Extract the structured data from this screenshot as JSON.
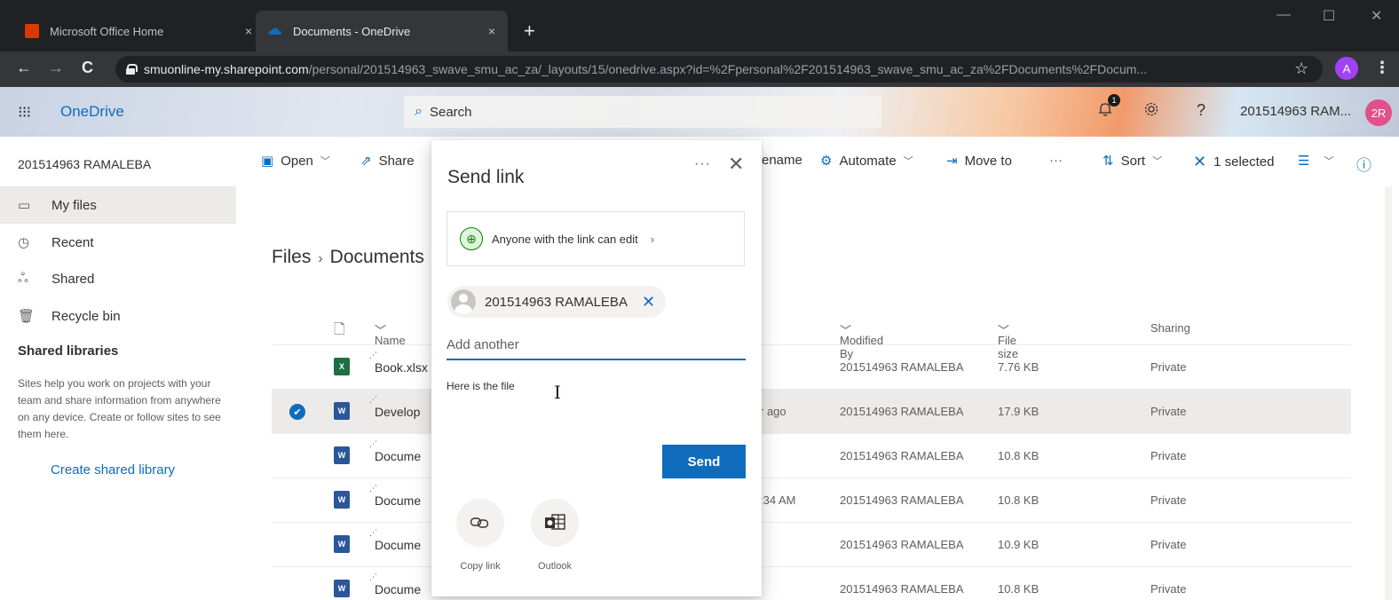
{
  "browser": {
    "tabs": [
      {
        "title": "Microsoft Office Home",
        "close": "×"
      },
      {
        "title": "Documents - OneDrive",
        "close": "×"
      }
    ],
    "new_tab": "+",
    "window": {
      "minimize": "—",
      "maximize": "☐",
      "close": "✕"
    },
    "nav": {
      "back": "←",
      "forward": "→",
      "reload": "C"
    },
    "url_host": "smuonline-my.sharepoint.com",
    "url_path": "/personal/201514963_swave_smu_ac_za/_layouts/15/onedrive.aspx?id=%2Fpersonal%2F201514963_swave_smu_ac_za%2FDocuments%2FDocum...",
    "star": "☆",
    "profile_initial": "A",
    "menu": "⋮"
  },
  "suite": {
    "waffle": "⁝⁝⁝",
    "brand": "OneDrive",
    "search_label": "Search",
    "notification_count": "1",
    "help": "?",
    "user_name": "201514963 RAM...",
    "avatar_initials": "2R"
  },
  "leftnav": {
    "user": "201514963 RAMALEBA",
    "items": [
      {
        "label": "My files",
        "icon": "▭"
      },
      {
        "label": "Recent",
        "icon": "◷"
      },
      {
        "label": "Shared",
        "icon": "ஃ"
      },
      {
        "label": "Recycle bin",
        "icon": "🗑"
      }
    ],
    "section": "Shared libraries",
    "help_text": "Sites help you work on projects with your team and share information from anywhere on any device. Create or follow sites to see them here.",
    "create_link": "Create shared library"
  },
  "commands": {
    "open": "Open",
    "share": "Share",
    "rename": "ename",
    "automate": "Automate",
    "move_to": "Move to",
    "more": "···",
    "sort": "Sort",
    "selected": "1 selected",
    "info": "ⓘ"
  },
  "breadcrumb": {
    "root": "Files",
    "current": "Documents"
  },
  "list": {
    "headers": {
      "name": "Name",
      "modified_by": "Modified By",
      "file_size": "File size",
      "sharing": "Sharing"
    },
    "rows": [
      {
        "name": "Book.xlsx",
        "type": "xlsx",
        "modified": "",
        "modified_by": "201514963 RAMALEBA",
        "size": "7.76 KB",
        "sharing": "Private",
        "selected": false
      },
      {
        "name": "Develop",
        "type": "docx",
        "modified": "r ago",
        "modified_by": "201514963 RAMALEBA",
        "size": "17.9 KB",
        "sharing": "Private",
        "selected": true
      },
      {
        "name": "Docume",
        "type": "docx",
        "modified": "",
        "modified_by": "201514963 RAMALEBA",
        "size": "10.8 KB",
        "sharing": "Private",
        "selected": false
      },
      {
        "name": "Docume",
        "type": "docx",
        "modified": ":34 AM",
        "modified_by": "201514963 RAMALEBA",
        "size": "10.8 KB",
        "sharing": "Private",
        "selected": false
      },
      {
        "name": "Docume",
        "type": "docx",
        "modified": "",
        "modified_by": "201514963 RAMALEBA",
        "size": "10.9 KB",
        "sharing": "Private",
        "selected": false
      },
      {
        "name": "Docume",
        "type": "docx",
        "modified": "",
        "modified_by": "201514963 RAMALEBA",
        "size": "10.8 KB",
        "sharing": "Private",
        "selected": false
      }
    ]
  },
  "dialog": {
    "title": "Send link",
    "more": "···",
    "close": "✕",
    "permission": "Anyone with the link can edit",
    "recipient": "201514963 RAMALEBA",
    "add_placeholder": "Add another",
    "message": "Here is the file",
    "send": "Send",
    "options": [
      {
        "label": "Copy link",
        "icon": "link-icon"
      },
      {
        "label": "Outlook",
        "icon": "outlook-icon"
      }
    ]
  },
  "colors": {
    "accent": "#0f6cbd",
    "selected_row": "#edebe9",
    "excel": "#1d6f42",
    "word": "#2b579a"
  }
}
